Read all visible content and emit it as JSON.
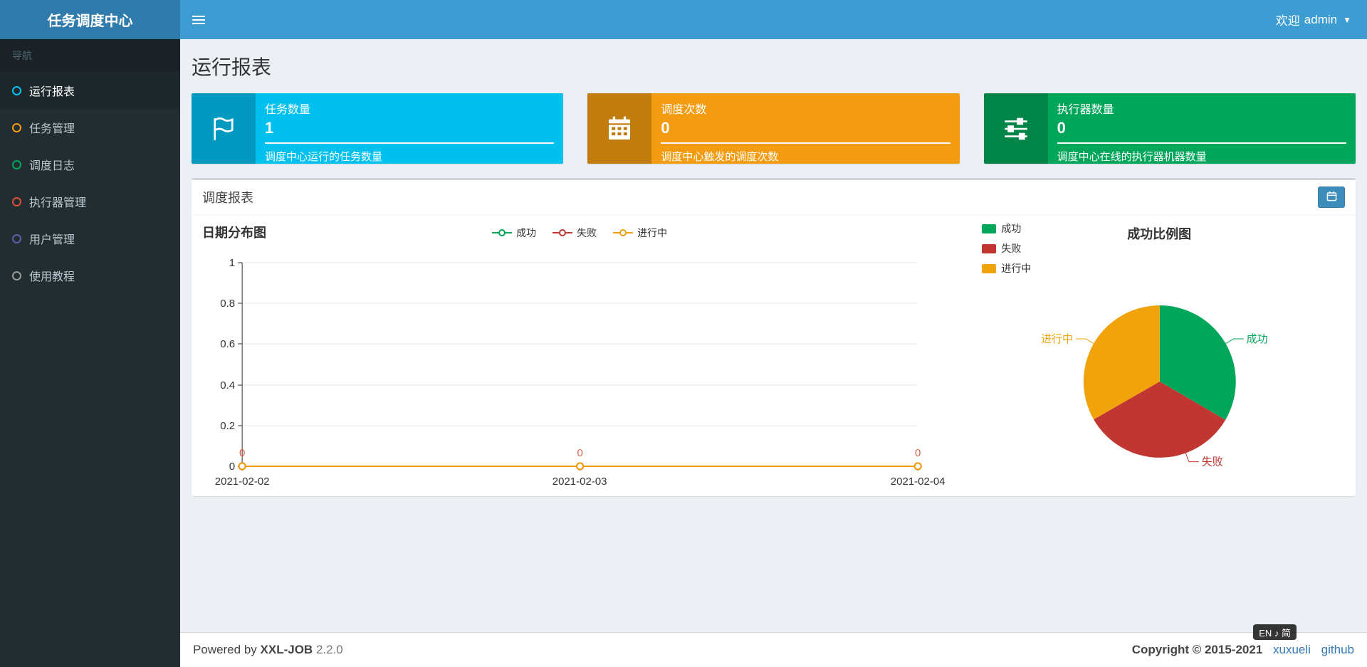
{
  "app": {
    "title": "任务调度中心"
  },
  "header": {
    "welcome_label": "欢迎",
    "username": "admin"
  },
  "sidebar": {
    "nav_label": "导航",
    "items": [
      {
        "label": "运行报表",
        "icon_color": "#00c0ef",
        "active": true
      },
      {
        "label": "任务管理",
        "icon_color": "#f39c12",
        "active": false
      },
      {
        "label": "调度日志",
        "icon_color": "#00a65a",
        "active": false
      },
      {
        "label": "执行器管理",
        "icon_color": "#dd4b39",
        "active": false
      },
      {
        "label": "用户管理",
        "icon_color": "#605ca8",
        "active": false
      },
      {
        "label": "使用教程",
        "icon_color": "#999999",
        "active": false
      }
    ]
  },
  "page": {
    "title": "运行报表"
  },
  "info_boxes": [
    {
      "title": "任务数量",
      "value": "1",
      "desc": "调度中心运行的任务数量",
      "color": "#00c0ef",
      "icon": "flag-icon"
    },
    {
      "title": "调度次数",
      "value": "0",
      "desc": "调度中心触发的调度次数",
      "color": "#f39c12",
      "icon": "calendar-icon"
    },
    {
      "title": "执行器数量",
      "value": "0",
      "desc": "调度中心在线的执行器机器数量",
      "color": "#00a65a",
      "icon": "sliders-icon"
    }
  ],
  "panel": {
    "title": "调度报表"
  },
  "chart_data": [
    {
      "type": "line",
      "title": "日期分布图",
      "x": [
        "2021-02-02",
        "2021-02-03",
        "2021-02-04"
      ],
      "series": [
        {
          "name": "成功",
          "color": "#00a65a",
          "values": [
            0,
            0,
            0
          ]
        },
        {
          "name": "失败",
          "color": "#c23632",
          "values": [
            0,
            0,
            0
          ]
        },
        {
          "name": "进行中",
          "color": "#f39c12",
          "values": [
            0,
            0,
            0
          ]
        }
      ],
      "ylim": [
        0,
        1
      ],
      "yticks": [
        "1",
        "0.8",
        "0.6",
        "0.4",
        "0.2",
        "0"
      ],
      "point_labels": [
        "0",
        "0",
        "0"
      ],
      "point_label_color": "#dd6048",
      "legend_position": "top",
      "grid": true
    },
    {
      "type": "pie",
      "title": "成功比例图",
      "slices": [
        {
          "name": "成功",
          "color": "#00a65a",
          "value": 33.4
        },
        {
          "name": "失败",
          "color": "#c23632",
          "value": 33.3
        },
        {
          "name": "进行中",
          "color": "#f0a30a",
          "value": 33.3
        }
      ],
      "legend_position": "left"
    }
  ],
  "footer": {
    "powered_prefix": "Powered by",
    "product": "XXL-JOB",
    "version": "2.2.0",
    "copyright": "Copyright © 2015-2021",
    "links": [
      {
        "label": "xuxueli"
      },
      {
        "label": "github"
      }
    ]
  },
  "ime": {
    "text": "EN ♪ 简"
  }
}
